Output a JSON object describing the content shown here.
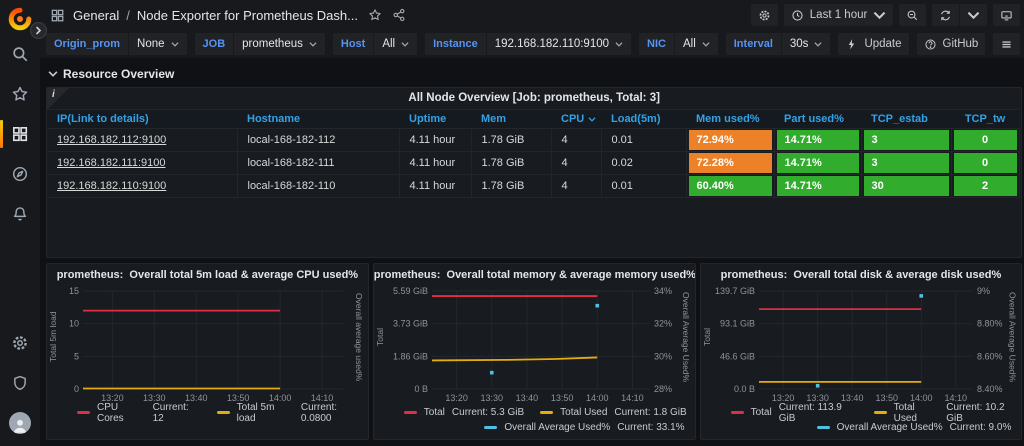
{
  "colors": {
    "green": "#32AC2D",
    "orange": "#ED8128",
    "red": "#E02F44",
    "yellow": "#E5AC0E",
    "cyan": "#4EC1E0",
    "blue_label": "#5794F2",
    "blue_header": "#33A2E5"
  },
  "topbar": {
    "breadcrumb_section": "General",
    "breadcrumb_separator": "/",
    "breadcrumb_title": "Node Exporter for Prometheus Dash...",
    "time_range": "Last 1 hour"
  },
  "toolbar": {
    "variables": [
      {
        "label": "Origin_prom",
        "value": "None"
      },
      {
        "label": "JOB",
        "value": "prometheus"
      },
      {
        "label": "Host",
        "value": "All"
      },
      {
        "label": "Instance",
        "value": "192.168.182.110:9100"
      },
      {
        "label": "NIC",
        "value": "All"
      },
      {
        "label": "Interval",
        "value": "30s"
      }
    ],
    "update_label": "Update",
    "github_label": "GitHub"
  },
  "section": {
    "title": "Resource Overview"
  },
  "table": {
    "info_icon": "i",
    "panel_title": "All Node Overview [Job: prometheus, Total: 3]",
    "columns": [
      "IP(Link to details)",
      "Hostname",
      "Uptime",
      "Mem",
      "CPU",
      "Load(5m)",
      "Mem used%",
      "Part used%",
      "TCP_estab",
      "TCP_tw"
    ],
    "rows": [
      {
        "ip": "192.168.182.112:9100",
        "hostname": "local-168-182-112",
        "uptime": "4.11 hour",
        "mem": "1.78 GiB",
        "cpu": "4",
        "load": "0.01",
        "mem_used": {
          "text": "72.94%",
          "state": "orange"
        },
        "part_used": {
          "text": "14.71%",
          "state": "green"
        },
        "tcp_estab": {
          "text": "3",
          "state": "green"
        },
        "tcp_tw": {
          "text": "0",
          "state": "green"
        }
      },
      {
        "ip": "192.168.182.111:9100",
        "hostname": "local-168-182-111",
        "uptime": "4.11 hour",
        "mem": "1.78 GiB",
        "cpu": "4",
        "load": "0.02",
        "mem_used": {
          "text": "72.28%",
          "state": "orange"
        },
        "part_used": {
          "text": "14.71%",
          "state": "green"
        },
        "tcp_estab": {
          "text": "3",
          "state": "green"
        },
        "tcp_tw": {
          "text": "0",
          "state": "green"
        }
      },
      {
        "ip": "192.168.182.110:9100",
        "hostname": "local-168-182-110",
        "uptime": "4.11 hour",
        "mem": "1.78 GiB",
        "cpu": "4",
        "load": "0.01",
        "mem_used": {
          "text": "60.40%",
          "state": "green"
        },
        "part_used": {
          "text": "14.71%",
          "state": "green"
        },
        "tcp_estab": {
          "text": "30",
          "state": "green"
        },
        "tcp_tw": {
          "text": "2",
          "state": "green"
        }
      }
    ]
  },
  "chart_data": [
    {
      "type": "line",
      "title": "prometheus:  Overall total 5m load & average CPU used%",
      "ylabel_left": "Total 5m load",
      "ylabel_right": "Overall average used%",
      "left_axis": {
        "min": 0,
        "max": 15,
        "ticks": [
          0,
          5,
          10,
          15
        ],
        "tick_labels": [
          "0",
          "5",
          "10",
          "15"
        ]
      },
      "right_axis": {
        "min": 0,
        "max": 1,
        "ticks": [],
        "tick_labels": []
      },
      "x_axis": {
        "min": 793,
        "max": 855,
        "ticks": [
          800,
          810,
          820,
          830,
          840,
          850
        ],
        "tick_labels": [
          "13:20",
          "13:30",
          "13:40",
          "13:50",
          "14:00",
          "14:10"
        ]
      },
      "series": [
        {
          "name": "CPU Cores",
          "current": "Current: 12",
          "color": "red",
          "axis": "left",
          "draw": "line",
          "x": [
            793,
            840
          ],
          "y": [
            12,
            12
          ]
        },
        {
          "name": "Total 5m load",
          "current": "Current: 0.0800",
          "color": "yellow",
          "axis": "left",
          "draw": "line",
          "x": [
            793,
            840
          ],
          "y": [
            0.08,
            0.08
          ]
        }
      ],
      "legend_rows": [
        [
          0,
          1
        ]
      ],
      "layout": {
        "left_margin": 24,
        "right_margin": 10
      }
    },
    {
      "type": "line",
      "title": "prometheus:  Overall total memory & average memory used%",
      "ylabel_left": "Total",
      "ylabel_right": "Overall Average Used%",
      "left_axis": {
        "min": 0,
        "max": 5.59,
        "ticks": [
          0,
          1.86,
          3.73,
          5.59
        ],
        "tick_labels": [
          "0 B",
          "1.86 GiB",
          "3.73 GiB",
          "5.59 GiB"
        ]
      },
      "right_axis": {
        "min": 28,
        "max": 34,
        "ticks": [
          28,
          30,
          32,
          34
        ],
        "tick_labels": [
          "28%",
          "30%",
          "32%",
          "34%"
        ]
      },
      "x_axis": {
        "min": 793,
        "max": 855,
        "ticks": [
          800,
          810,
          820,
          830,
          840,
          850
        ],
        "tick_labels": [
          "13:20",
          "13:30",
          "13:40",
          "13:50",
          "14:00",
          "14:10"
        ]
      },
      "series": [
        {
          "name": "Total",
          "current": "Current: 5.3 GiB",
          "color": "red",
          "axis": "left",
          "draw": "line",
          "x": [
            793,
            840
          ],
          "y": [
            5.3,
            5.3
          ]
        },
        {
          "name": "Total Used",
          "current": "Current: 1.8 GiB",
          "color": "yellow",
          "axis": "left",
          "draw": "line",
          "x": [
            793,
            814,
            828,
            840
          ],
          "y": [
            1.63,
            1.66,
            1.71,
            1.8
          ]
        },
        {
          "name": "Overall Average Used%",
          "current": "Current: 33.1%",
          "color": "cyan",
          "axis": "right",
          "draw": "points",
          "x": [
            810,
            840
          ],
          "y": [
            29.0,
            33.1
          ]
        }
      ],
      "legend_rows": [
        [
          0,
          1
        ],
        [
          2
        ]
      ],
      "layout": {
        "left_margin": 46,
        "right_margin": 30
      }
    },
    {
      "type": "line",
      "title": "prometheus:  Overall total disk & average disk used%",
      "ylabel_left": "Total",
      "ylabel_right": "Overall Average Used%",
      "left_axis": {
        "min": 0,
        "max": 139.7,
        "ticks": [
          0,
          46.6,
          93.1,
          139.7
        ],
        "tick_labels": [
          "0.0 B",
          "46.6 GiB",
          "93.1 GiB",
          "139.7 GiB"
        ]
      },
      "right_axis": {
        "min": 8.4,
        "max": 9.0,
        "ticks": [
          8.4,
          8.6,
          8.8,
          9.0
        ],
        "tick_labels": [
          "8.40%",
          "8.60%",
          "8.80%",
          "9%"
        ]
      },
      "x_axis": {
        "min": 793,
        "max": 855,
        "ticks": [
          800,
          810,
          820,
          830,
          840,
          850
        ],
        "tick_labels": [
          "13:20",
          "13:30",
          "13:40",
          "13:50",
          "14:00",
          "14:10"
        ]
      },
      "series": [
        {
          "name": "Total",
          "current": "Current: 113.9 GiB",
          "color": "red",
          "axis": "left",
          "draw": "line",
          "x": [
            793,
            840
          ],
          "y": [
            113.9,
            113.9
          ]
        },
        {
          "name": "Total Used",
          "current": "Current: 10.2 GiB",
          "color": "yellow",
          "axis": "left",
          "draw": "line",
          "x": [
            793,
            840
          ],
          "y": [
            10.2,
            10.2
          ]
        },
        {
          "name": "Overall Average Used%",
          "current": "Current: 9.0%",
          "color": "cyan",
          "axis": "right",
          "draw": "points",
          "x": [
            810,
            840
          ],
          "y": [
            8.42,
            8.97
          ]
        }
      ],
      "legend_rows": [
        [
          0,
          1
        ],
        [
          2
        ]
      ],
      "layout": {
        "left_margin": 46,
        "right_margin": 34
      }
    }
  ]
}
